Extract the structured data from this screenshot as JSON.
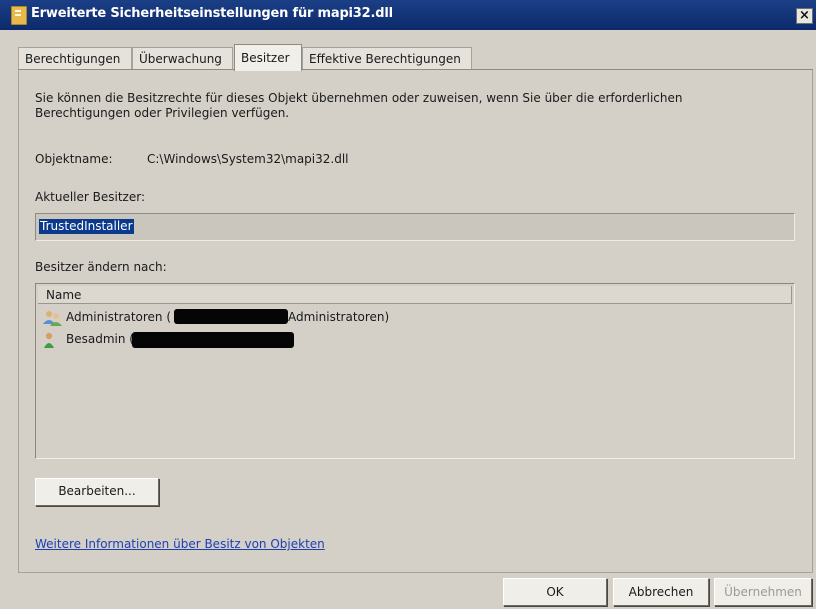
{
  "window": {
    "title": "Erweiterte Sicherheitseinstellungen für mapi32.dll",
    "close_label": "×"
  },
  "tabs": [
    {
      "label": "Berechtigungen",
      "active": false
    },
    {
      "label": "Überwachung",
      "active": false
    },
    {
      "label": "Besitzer",
      "active": true
    },
    {
      "label": "Effektive Berechtigungen",
      "active": false
    }
  ],
  "panel": {
    "description": "Sie können die Besitzrechte für dieses Objekt übernehmen oder zuweisen, wenn Sie über die erforderlichen Berechtigungen oder Privilegien verfügen.",
    "object_name_label": "Objektname:",
    "object_name_value": "C:\\Windows\\System32\\mapi32.dll",
    "current_owner_label": "Aktueller Besitzer:",
    "current_owner_value": "TrustedInstaller",
    "change_owner_label": "Besitzer ändern nach:",
    "list": {
      "column_header": "Name",
      "items": [
        {
          "prefix": "Administratoren (",
          "suffix": "Administratoren)",
          "icon": "users-group-icon",
          "redacted": true
        },
        {
          "prefix": "Besadmin (",
          "suffix": "",
          "icon": "user-icon",
          "redacted": true
        }
      ]
    },
    "edit_button": "Bearbeiten...",
    "info_link": "Weitere Informationen über Besitz von Objekten"
  },
  "buttons": {
    "ok": "OK",
    "cancel": "Abbrechen",
    "apply": "Übernehmen",
    "apply_enabled": false
  }
}
